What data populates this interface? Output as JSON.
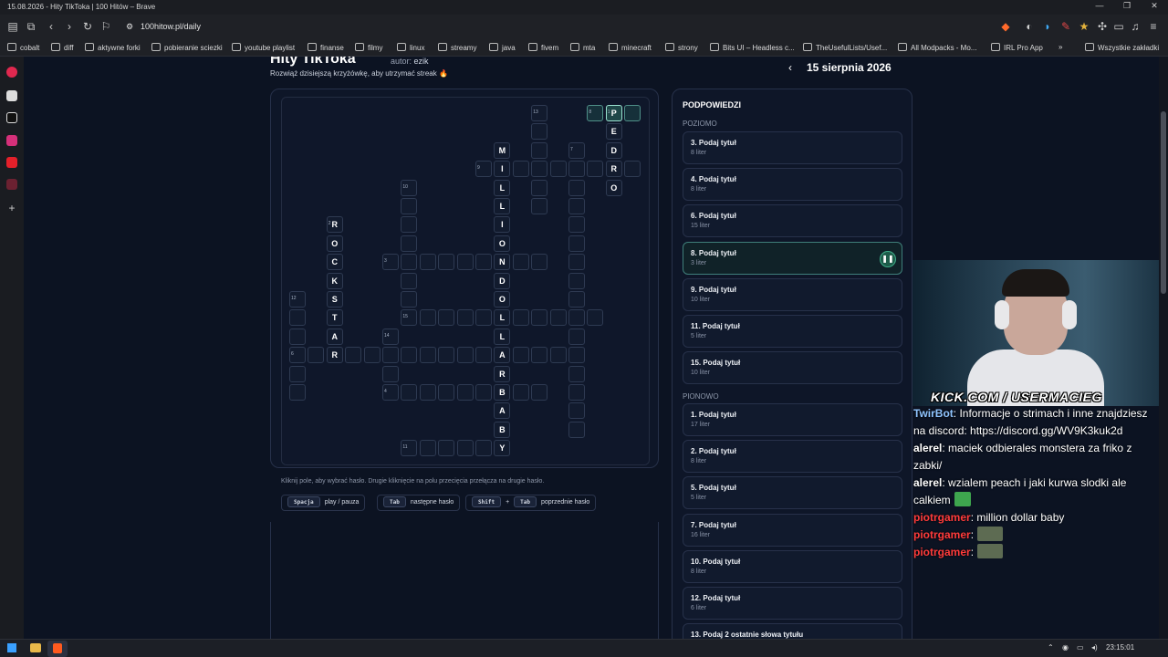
{
  "window": {
    "title": "15.08.2026 - Hity TikToka | 100 Hitów – Brave"
  },
  "browser": {
    "url": "100hitow.pl/daily",
    "bookmarks": [
      "cobalt",
      "diff",
      "aktywne forki",
      "pobieranie sciezki",
      "youtube playlist",
      "finanse",
      "filmy",
      "linux",
      "streamy",
      "java",
      "fivem",
      "mta",
      "minecraft",
      "strony",
      "Bits UI – Headless c...",
      "TheUsefulLists/Usef...",
      "All Modpacks - Mo...",
      "IRL Pro App",
      "»",
      "Wszystkie zakładki"
    ]
  },
  "header": {
    "title": "Hity TikToka",
    "author_label": "autor:",
    "author": "ezik",
    "subtitle": "Rozwiąż dzisiejszą krzyżówkę, aby utrzymać streak 🔥",
    "date": "15 sierpnia 2026",
    "prev": "‹"
  },
  "hints": {
    "instructions": "Kliknij pole, aby wybrać hasło. Drugie kliknięcie na polu przecięcia przełącza na drugie hasło.",
    "shortcuts": [
      {
        "keys": [
          "Spacja"
        ],
        "label": "play / pauza"
      },
      {
        "keys": [
          "Tab"
        ],
        "label": "następne hasło"
      },
      {
        "keys": [
          "Shift",
          "Tab"
        ],
        "label": "poprzednie hasło",
        "plus": "+"
      }
    ]
  },
  "clues": {
    "title": "PODPOWIEDZI",
    "across_label": "POZIOMO",
    "down_label": "PIONOWO",
    "across": [
      {
        "title": "3. Podaj tytuł",
        "letters": "8 liter"
      },
      {
        "title": "4. Podaj tytuł",
        "letters": "8 liter"
      },
      {
        "title": "6. Podaj tytuł",
        "letters": "15 liter"
      },
      {
        "title": "8. Podaj tytuł",
        "letters": "3 liter",
        "active": true
      },
      {
        "title": "9. Podaj tytuł",
        "letters": "10 liter"
      },
      {
        "title": "11. Podaj tytuł",
        "letters": "5 liter"
      },
      {
        "title": "15. Podaj tytuł",
        "letters": "10 liter"
      }
    ],
    "down": [
      {
        "title": "1. Podaj tytuł",
        "letters": "17 liter"
      },
      {
        "title": "2. Podaj tytuł",
        "letters": "8 liter"
      },
      {
        "title": "5. Podaj tytuł",
        "letters": "5 liter"
      },
      {
        "title": "7. Podaj tytuł",
        "letters": "16 liter"
      },
      {
        "title": "10. Podaj tytuł",
        "letters": "8 liter"
      },
      {
        "title": "12. Podaj tytuł",
        "letters": "6 liter"
      },
      {
        "title": "13. Podaj 2 ostatnie słowa tytułu",
        "letters": ""
      }
    ],
    "play_icon": "pause-icon"
  },
  "stream": {
    "overlay_text": "KICK.COM / USERMACIEG",
    "chat": [
      {
        "user": "TwirBot",
        "color": "#8fc4ff",
        "text": ": Informacje o strimach i inne znajdziesz na discord: https://discord.gg/WV9K3kuk2d"
      },
      {
        "user": "alerel",
        "color": "#ffffff",
        "text": ": maciek odbierales monstera za friko z zabki/"
      },
      {
        "user": "alerel",
        "color": "#ffffff",
        "text": ": wzialem peach i jaki kurwa slodki ale calkiem",
        "emote": "green"
      },
      {
        "user": "piotrgamer",
        "color": "#ff3b3b",
        "text": ": million dollar baby"
      },
      {
        "user": "piotrgamer",
        "color": "#ff3b3b",
        "text": ":",
        "emote": "img"
      },
      {
        "user": "piotrgamer",
        "color": "#ff3b3b",
        "text": ":",
        "emote": "img"
      }
    ]
  },
  "taskbar": {
    "time": "23:15:01"
  },
  "crossword": {
    "cells": [
      {
        "c": 13,
        "r": 0,
        "n": "13"
      },
      {
        "c": 16,
        "r": 0,
        "n": "8",
        "cls": "active"
      },
      {
        "c": 17,
        "r": 0,
        "n": "1",
        "l": "P",
        "cls": "sel"
      },
      {
        "c": 18,
        "r": 0,
        "cls": "active"
      },
      {
        "c": 13,
        "r": 1
      },
      {
        "c": 17,
        "r": 1,
        "l": "E"
      },
      {
        "c": 11,
        "r": 2,
        "l": "M"
      },
      {
        "c": 13,
        "r": 2
      },
      {
        "c": 15,
        "r": 2,
        "n": "7"
      },
      {
        "c": 17,
        "r": 2,
        "l": "D"
      },
      {
        "c": 10,
        "r": 3,
        "n": "9"
      },
      {
        "c": 11,
        "r": 3,
        "l": "I"
      },
      {
        "c": 12,
        "r": 3
      },
      {
        "c": 13,
        "r": 3
      },
      {
        "c": 14,
        "r": 3
      },
      {
        "c": 15,
        "r": 3
      },
      {
        "c": 16,
        "r": 3
      },
      {
        "c": 17,
        "r": 3,
        "l": "R"
      },
      {
        "c": 18,
        "r": 3
      },
      {
        "c": 6,
        "r": 4,
        "n": "10"
      },
      {
        "c": 11,
        "r": 4,
        "l": "L"
      },
      {
        "c": 13,
        "r": 4
      },
      {
        "c": 15,
        "r": 4
      },
      {
        "c": 17,
        "r": 4,
        "l": "O"
      },
      {
        "c": 6,
        "r": 5
      },
      {
        "c": 11,
        "r": 5,
        "l": "L"
      },
      {
        "c": 13,
        "r": 5
      },
      {
        "c": 15,
        "r": 5
      },
      {
        "c": 2,
        "r": 6,
        "n": "2",
        "l": "R"
      },
      {
        "c": 6,
        "r": 6
      },
      {
        "c": 11,
        "r": 6,
        "l": "I"
      },
      {
        "c": 15,
        "r": 6
      },
      {
        "c": 2,
        "r": 7,
        "l": "O"
      },
      {
        "c": 6,
        "r": 7
      },
      {
        "c": 11,
        "r": 7,
        "l": "O"
      },
      {
        "c": 15,
        "r": 7
      },
      {
        "c": 2,
        "r": 8,
        "l": "C"
      },
      {
        "c": 5,
        "r": 8,
        "n": "3"
      },
      {
        "c": 6,
        "r": 8
      },
      {
        "c": 7,
        "r": 8
      },
      {
        "c": 8,
        "r": 8
      },
      {
        "c": 9,
        "r": 8
      },
      {
        "c": 10,
        "r": 8
      },
      {
        "c": 11,
        "r": 8,
        "l": "N"
      },
      {
        "c": 12,
        "r": 8
      },
      {
        "c": 13,
        "r": 8
      },
      {
        "c": 15,
        "r": 8
      },
      {
        "c": 2,
        "r": 9,
        "l": "K"
      },
      {
        "c": 6,
        "r": 9
      },
      {
        "c": 11,
        "r": 9,
        "l": "D"
      },
      {
        "c": 15,
        "r": 9
      },
      {
        "c": 0,
        "r": 10,
        "n": "12"
      },
      {
        "c": 2,
        "r": 10,
        "l": "S"
      },
      {
        "c": 6,
        "r": 10
      },
      {
        "c": 11,
        "r": 10,
        "l": "O"
      },
      {
        "c": 15,
        "r": 10
      },
      {
        "c": 0,
        "r": 11
      },
      {
        "c": 2,
        "r": 11,
        "l": "T"
      },
      {
        "c": 6,
        "r": 11,
        "n": "15"
      },
      {
        "c": 7,
        "r": 11
      },
      {
        "c": 8,
        "r": 11
      },
      {
        "c": 9,
        "r": 11
      },
      {
        "c": 10,
        "r": 11
      },
      {
        "c": 11,
        "r": 11,
        "l": "L"
      },
      {
        "c": 12,
        "r": 11
      },
      {
        "c": 13,
        "r": 11
      },
      {
        "c": 14,
        "r": 11
      },
      {
        "c": 15,
        "r": 11
      },
      {
        "c": 16,
        "r": 11
      },
      {
        "c": 0,
        "r": 12
      },
      {
        "c": 2,
        "r": 12,
        "l": "A"
      },
      {
        "c": 5,
        "r": 12,
        "n": "14"
      },
      {
        "c": 11,
        "r": 12,
        "l": "L"
      },
      {
        "c": 15,
        "r": 12
      },
      {
        "c": 0,
        "r": 13,
        "n": "6"
      },
      {
        "c": 1,
        "r": 13
      },
      {
        "c": 2,
        "r": 13,
        "l": "R"
      },
      {
        "c": 3,
        "r": 13
      },
      {
        "c": 4,
        "r": 13
      },
      {
        "c": 5,
        "r": 13
      },
      {
        "c": 6,
        "r": 13
      },
      {
        "c": 7,
        "r": 13
      },
      {
        "c": 8,
        "r": 13
      },
      {
        "c": 9,
        "r": 13
      },
      {
        "c": 10,
        "r": 13
      },
      {
        "c": 11,
        "r": 13,
        "l": "A"
      },
      {
        "c": 12,
        "r": 13
      },
      {
        "c": 13,
        "r": 13
      },
      {
        "c": 14,
        "r": 13
      },
      {
        "c": 15,
        "r": 13
      },
      {
        "c": 0,
        "r": 14
      },
      {
        "c": 5,
        "r": 14
      },
      {
        "c": 11,
        "r": 14,
        "l": "R"
      },
      {
        "c": 15,
        "r": 14
      },
      {
        "c": 0,
        "r": 15
      },
      {
        "c": 5,
        "r": 15,
        "n": "4"
      },
      {
        "c": 6,
        "r": 15
      },
      {
        "c": 7,
        "r": 15
      },
      {
        "c": 8,
        "r": 15
      },
      {
        "c": 9,
        "r": 15
      },
      {
        "c": 10,
        "r": 15
      },
      {
        "c": 11,
        "r": 15,
        "l": "B"
      },
      {
        "c": 12,
        "r": 15
      },
      {
        "c": 13,
        "r": 15
      },
      {
        "c": 15,
        "r": 15
      },
      {
        "c": 11,
        "r": 16,
        "l": "A"
      },
      {
        "c": 15,
        "r": 16
      },
      {
        "c": 11,
        "r": 17,
        "l": "B"
      },
      {
        "c": 15,
        "r": 17
      },
      {
        "c": 6,
        "r": 18,
        "n": "11"
      },
      {
        "c": 7,
        "r": 18
      },
      {
        "c": 8,
        "r": 18
      },
      {
        "c": 9,
        "r": 18
      },
      {
        "c": 10,
        "r": 18
      },
      {
        "c": 11,
        "r": 18,
        "l": "Y"
      }
    ]
  }
}
